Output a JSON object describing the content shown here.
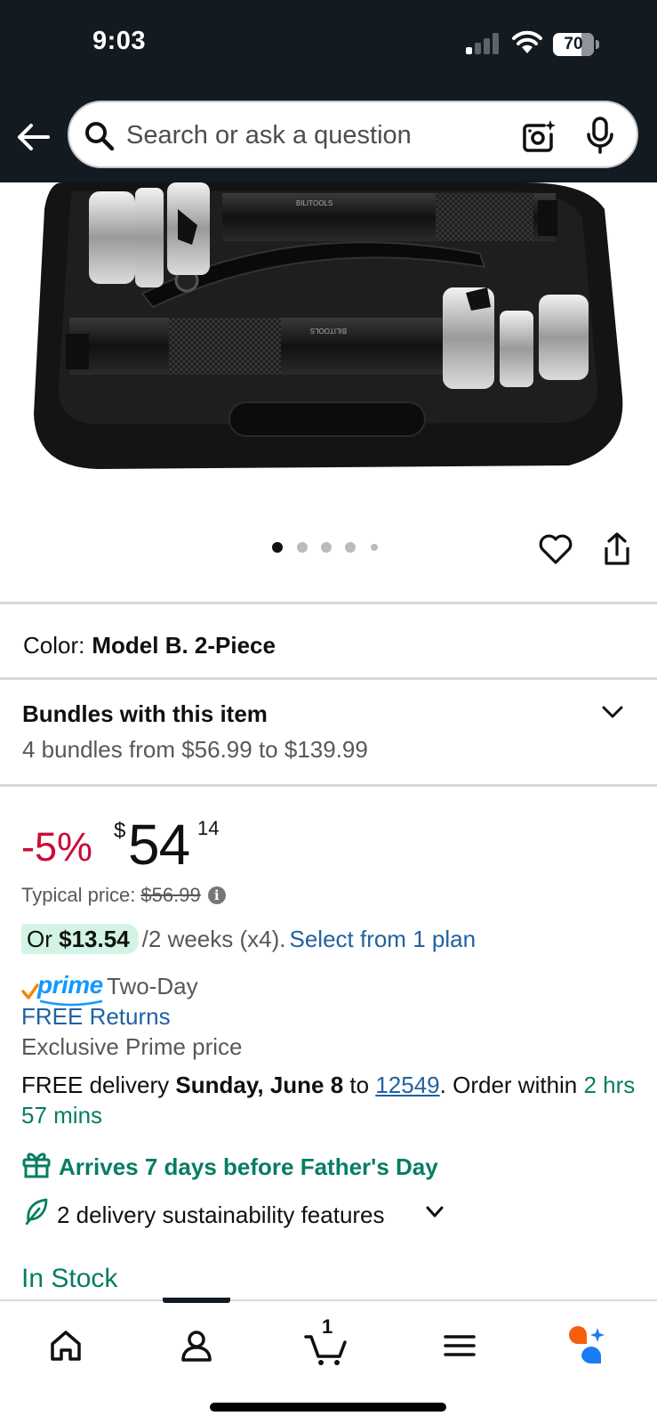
{
  "status_bar": {
    "time": "9:03",
    "battery": "70"
  },
  "search": {
    "placeholder": "Search or ask a question"
  },
  "product_image": {
    "brand_label": "BILITOOLS",
    "dots_total": 5,
    "active_dot": 1
  },
  "variation": {
    "label": "Color:",
    "value": "Model B. 2-Piece"
  },
  "bundles": {
    "title": "Bundles with this item",
    "subtitle": "4 bundles from $56.99 to $139.99"
  },
  "price": {
    "discount": "-5%",
    "currency": "$",
    "whole": "54",
    "fraction": "14",
    "typical_label": "Typical price:",
    "typical_value": "$56.99",
    "info_glyph": "i"
  },
  "installment": {
    "prefix": "Or",
    "amount": "$13.54",
    "terms": "/2 weeks (x4).",
    "link": "Select from 1 plan"
  },
  "prime": {
    "badge": "prime",
    "speed": "Two-Day"
  },
  "returns": "FREE Returns",
  "exclusive": "Exclusive Prime price",
  "delivery": {
    "prefix": "FREE delivery",
    "date": "Sunday, June 8",
    "to": "to",
    "zip": "12549",
    "order_within": ". Order within",
    "countdown": "2 hrs 57 mins"
  },
  "fathers_day": "Arrives 7 days before Father's Day",
  "sustainability": "2 delivery sustainability features",
  "stock": "In Stock",
  "bottom_nav": {
    "cart_count": "1"
  },
  "colors": {
    "header_bg": "#131a22",
    "deal_red": "#cc0c39",
    "link_blue": "#2162a1",
    "success_green": "#067d62",
    "prime_blue": "#1399ff",
    "installment_bg": "#d3f4e4"
  }
}
